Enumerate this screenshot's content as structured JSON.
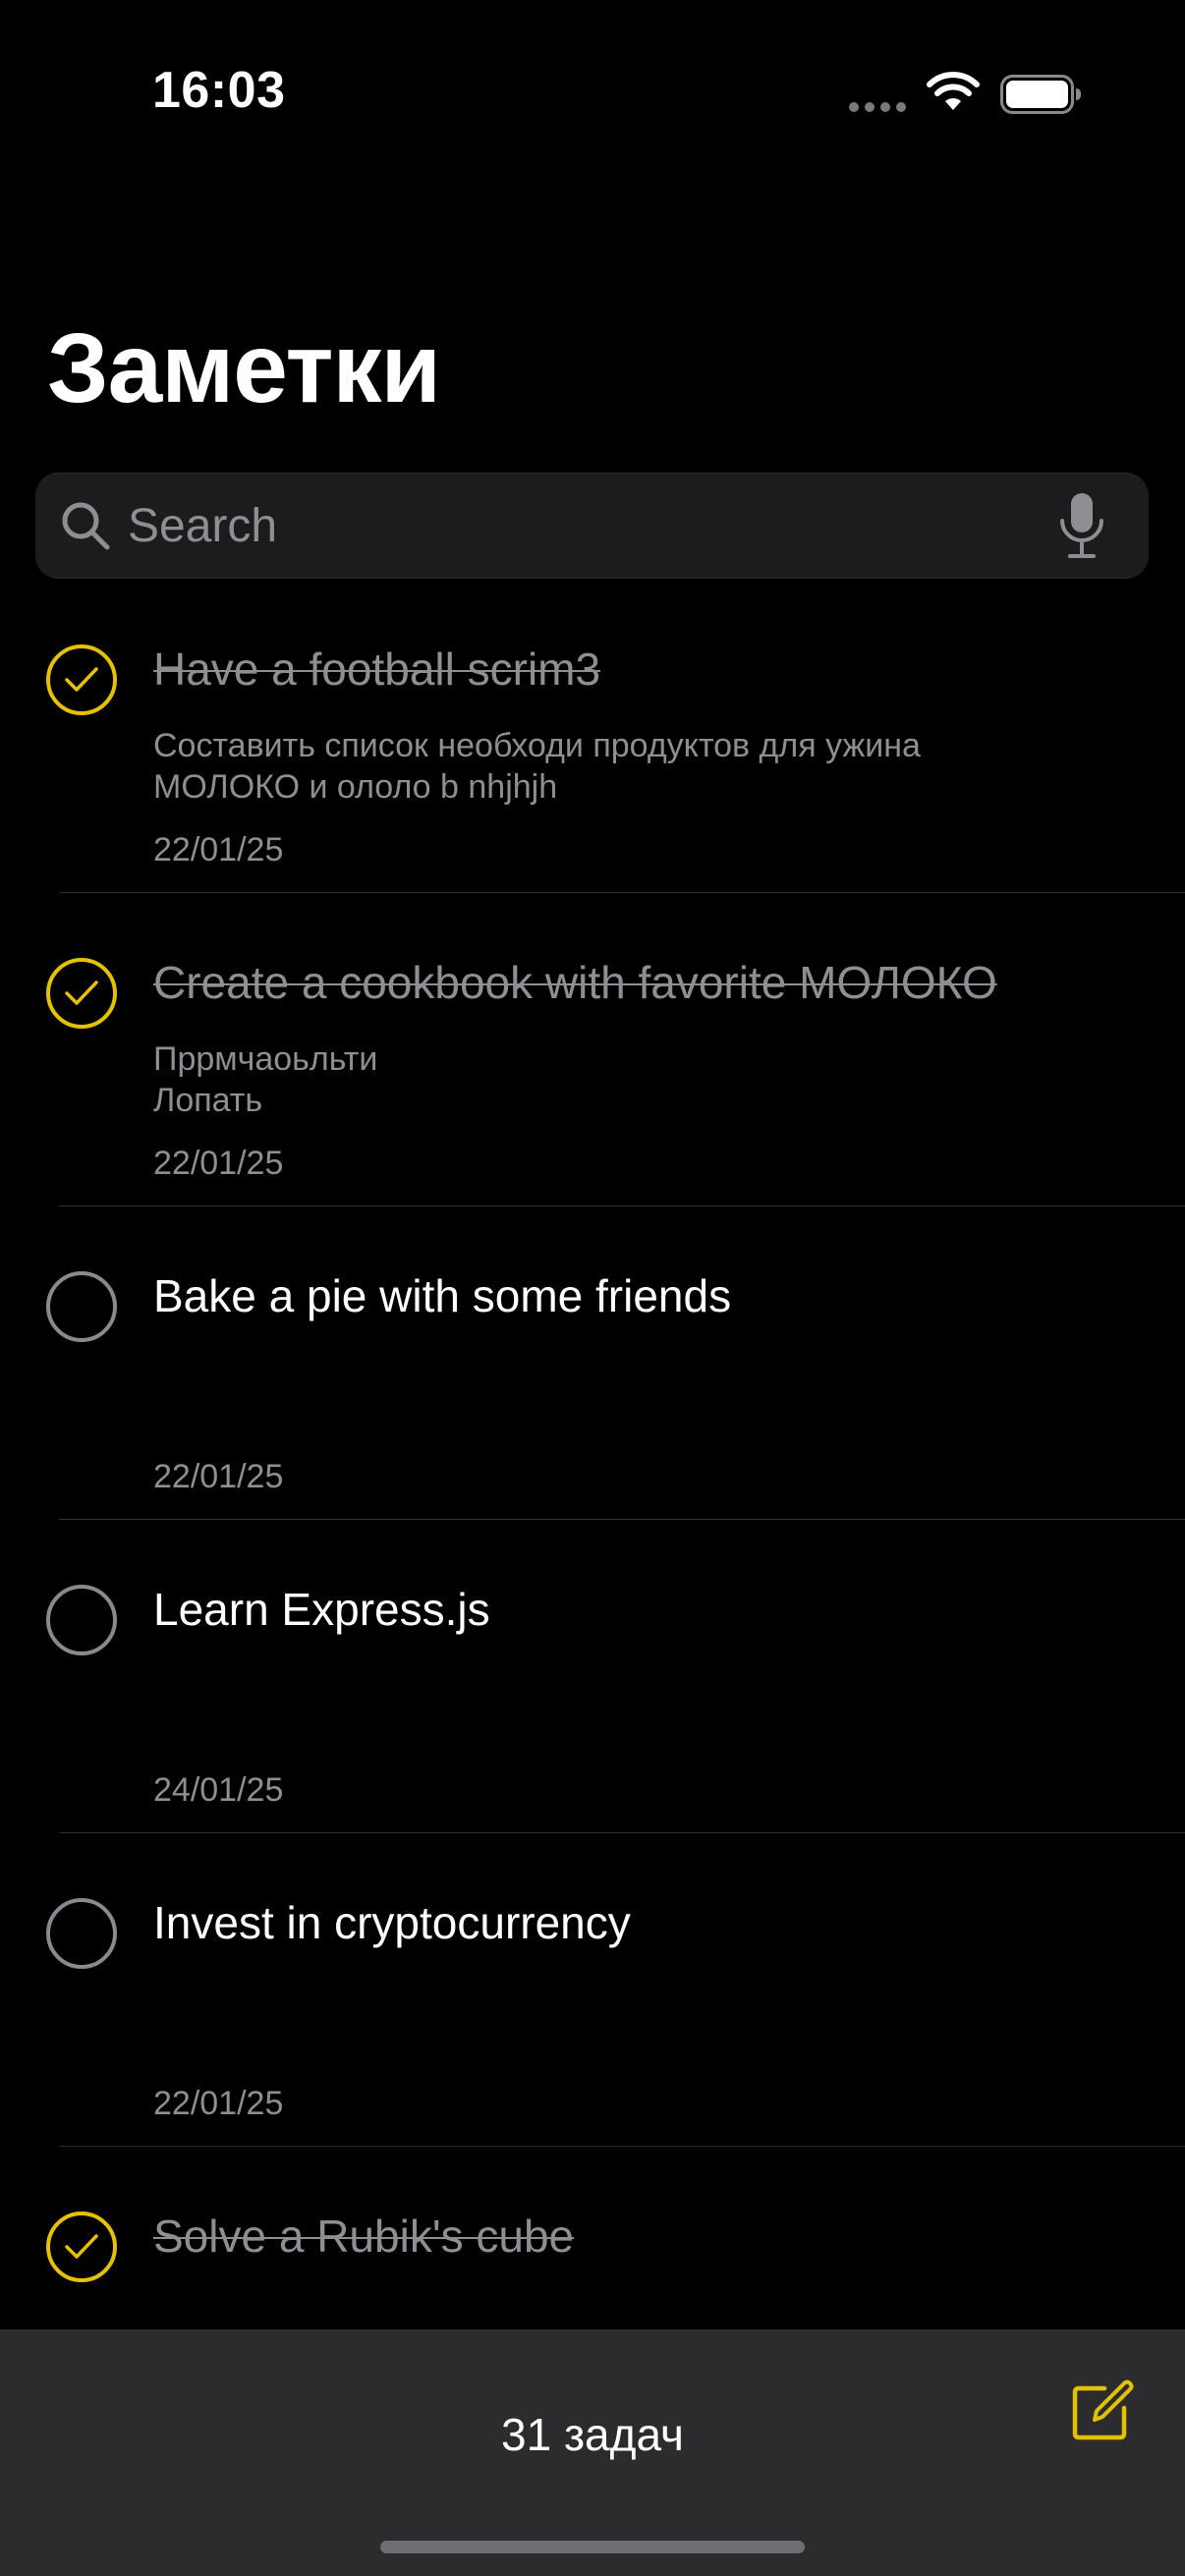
{
  "status_bar": {
    "time": "16:03"
  },
  "header": {
    "title": "Заметки"
  },
  "search": {
    "placeholder": "Search"
  },
  "tasks": [
    {
      "title": "Have a football scrim3",
      "description_lines": [
        "Составить список необходи продуктов для ужина",
        "МОЛОКО и ололо b nhjhjh"
      ],
      "date": "22/01/25",
      "completed": true
    },
    {
      "title": "Create a cookbook with favorite МОЛОКО",
      "description_lines": [
        "Пррмчаоьльти",
        "Лопать"
      ],
      "date": "22/01/25",
      "completed": true
    },
    {
      "title": "Bake a pie with some friends",
      "description_lines": [],
      "date": "22/01/25",
      "completed": false
    },
    {
      "title": "Learn Express.js",
      "description_lines": [],
      "date": "24/01/25",
      "completed": false
    },
    {
      "title": "Invest in cryptocurrency",
      "description_lines": [],
      "date": "22/01/25",
      "completed": false
    },
    {
      "title": "Solve a Rubik's cube",
      "description_lines": [],
      "date": "",
      "completed": true
    }
  ],
  "bottom_bar": {
    "count_label": "31 задач"
  },
  "icons": {
    "search": "search-icon",
    "mic": "microphone-icon",
    "compose": "compose-icon",
    "wifi": "wifi-icon",
    "battery": "battery-icon",
    "signal": "signal-icon",
    "checkmark": "checkmark-icon"
  },
  "colors": {
    "accent": "#e5c100",
    "background": "#000000",
    "secondary_text": "#8e8e93",
    "bottom_bar": "#2c2c2e"
  }
}
